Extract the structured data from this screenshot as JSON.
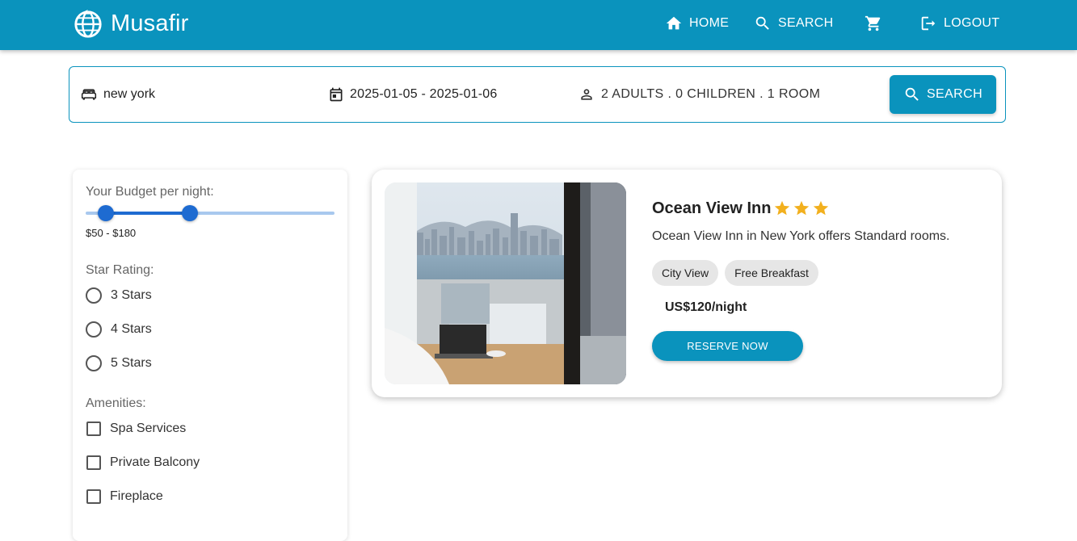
{
  "header": {
    "brand": "Musafir",
    "nav": {
      "home": "HOME",
      "search": "SEARCH",
      "logout": "LOGOUT"
    },
    "icons": [
      "globe-plane-icon",
      "home-icon",
      "search-icon",
      "cart-icon",
      "logout-icon"
    ]
  },
  "search_bar": {
    "destination": "new york",
    "dates": "2025-01-05 - 2025-01-06",
    "guests": "2 ADULTS . 0 CHILDREN . 1 ROOM",
    "button_label": "SEARCH"
  },
  "filters": {
    "budget": {
      "label": "Your Budget per night:",
      "value_text": "$50 - $180",
      "low_fraction": 0.08,
      "high_fraction": 0.42
    },
    "star_rating": {
      "label": "Star Rating:",
      "options": [
        "3 Stars",
        "4 Stars",
        "5 Stars"
      ]
    },
    "amenities": {
      "label": "Amenities:",
      "options": [
        "Spa Services",
        "Private Balcony",
        "Fireplace"
      ]
    }
  },
  "results": [
    {
      "name": "Ocean View Inn",
      "stars": 3,
      "description": "Ocean View Inn in New York offers Standard rooms.",
      "tags": [
        "City View",
        "Free Breakfast"
      ],
      "price": "US$120/night",
      "cta": "RESERVE NOW"
    }
  ],
  "colors": {
    "primary": "#0a93bd",
    "slider": "#1e6bd1",
    "star": "#f2b01e"
  }
}
